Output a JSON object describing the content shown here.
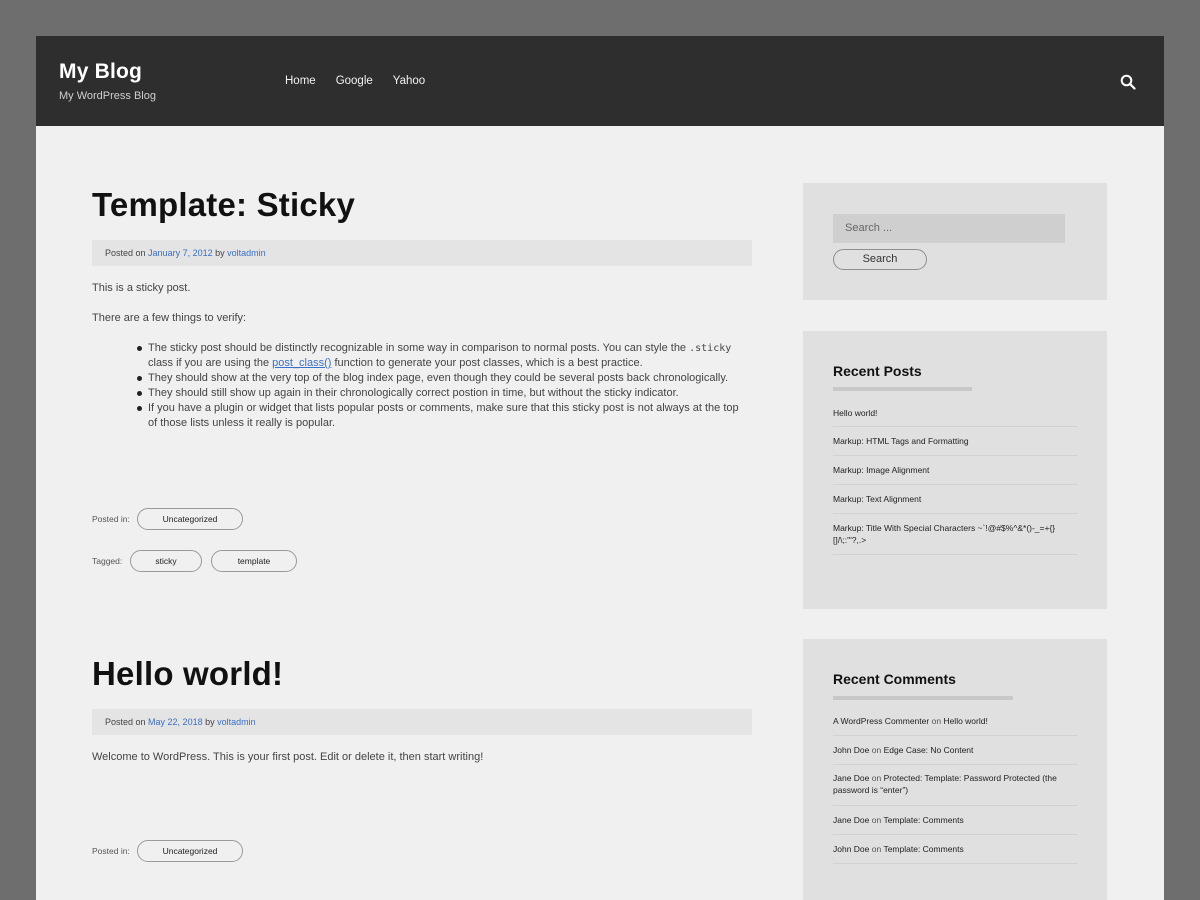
{
  "header": {
    "title": "My Blog",
    "description": "My WordPress Blog",
    "nav": [
      "Home",
      "Google",
      "Yahoo"
    ],
    "search_icon": "search-icon"
  },
  "posts": [
    {
      "title": "Template: Sticky",
      "meta_posted_on": "Posted on",
      "date": "January 7, 2012",
      "meta_by": "by",
      "author": "voltadmin",
      "para1": "This is a sticky post.",
      "para2": "There are a few things to verify:",
      "bullet1_a": "The sticky post should be distinctly recognizable in some way in comparison to normal posts. You can style the ",
      "bullet1_code": ".sticky",
      "bullet1_b": " class if you are using the ",
      "bullet1_link": "post_class()",
      "bullet1_c": " function to generate your post classes, which is a best practice.",
      "bullet2": "They should show at the very top of the blog index page, even though they could be several posts back chronologically.",
      "bullet3": "They should still show up again in their chronologically correct postion in time, but without the sticky indicator.",
      "bullet4": "If you have a plugin or widget that lists popular posts or comments, make sure that this sticky post is not always at the top of those lists unless it really is popular.",
      "posted_in_label": "Posted in:",
      "category": "Uncategorized",
      "tagged_label": "Tagged:",
      "tags": [
        "sticky",
        "template"
      ]
    },
    {
      "title": "Hello world!",
      "meta_posted_on": "Posted on",
      "date": "May 22, 2018",
      "meta_by": "by",
      "author": "voltadmin",
      "para1": "Welcome to WordPress. This is your first post. Edit or delete it, then start writing!",
      "posted_in_label": "Posted in:",
      "category": "Uncategorized"
    }
  ],
  "sidebar": {
    "search_placeholder": "Search ...",
    "search_button": "Search",
    "recent_posts_title": "Recent Posts",
    "recent_posts": [
      "Hello world!",
      "Markup: HTML Tags and Formatting",
      "Markup: Image Alignment",
      "Markup: Text Alignment",
      "Markup: Title With Special Characters ~`!@#$%^&*()-_=+{}[]/\\;:'\"?,.>"
    ],
    "recent_comments_title": "Recent Comments",
    "on_word": "on",
    "recent_comments": [
      {
        "author": "A WordPress Commenter",
        "post": "Hello world!"
      },
      {
        "author": "John Doe",
        "post": "Edge Case: No Content"
      },
      {
        "author": "Jane Doe",
        "post": "Protected: Template: Password Protected (the password is “enter”)"
      },
      {
        "author": "Jane Doe",
        "post": "Template: Comments"
      },
      {
        "author": "John Doe",
        "post": "Template: Comments"
      }
    ]
  },
  "colors": {
    "header_bg": "#2e2e2e",
    "link": "#3a6fc9",
    "page_bg": "#f0f0f0",
    "widget_bg": "#e0e0e0"
  }
}
